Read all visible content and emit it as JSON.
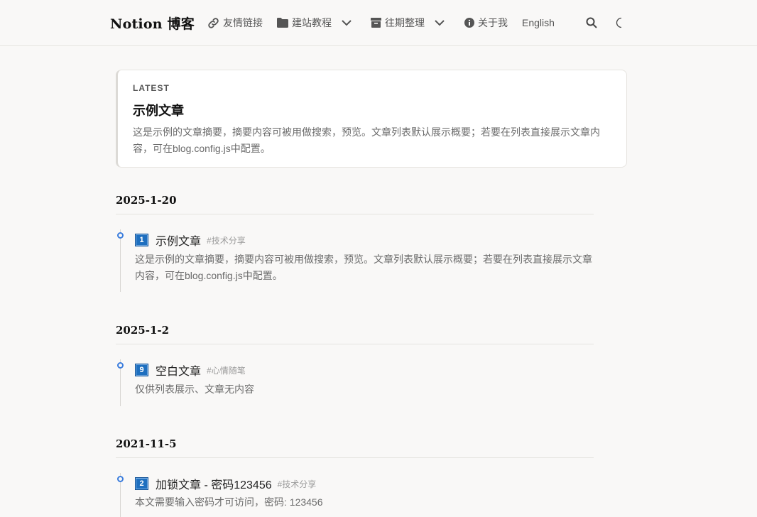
{
  "header": {
    "brand": "Notion 博客",
    "nav": [
      {
        "label": "友情链接",
        "icon": "link-icon"
      },
      {
        "label": "建站教程",
        "icon": "folder-icon",
        "dropdown": true
      },
      {
        "label": "往期整理",
        "icon": "archive-icon",
        "dropdown": true
      },
      {
        "label": "关于我",
        "icon": "info-icon"
      },
      {
        "label": "English"
      }
    ],
    "actions": {
      "search_icon": "search-icon",
      "theme_icon": "moon-icon"
    }
  },
  "latest": {
    "tag": "LATEST",
    "title": "示例文章",
    "summary": "这是示例的文章摘要，摘要内容可被用做搜索，预览。文章列表默认展示概要；若要在列表直接展示文章内容，可在blog.config.js中配置。"
  },
  "groups": [
    {
      "date": "2025-1-20",
      "posts": [
        {
          "num": "1",
          "title": "示例文章",
          "tag": "#技术分享",
          "summary": "这是示例的文章摘要，摘要内容可被用做搜索，预览。文章列表默认展示概要；若要在列表直接展示文章内容，可在blog.config.js中配置。"
        }
      ]
    },
    {
      "date": "2025-1-2",
      "posts": [
        {
          "num": "9",
          "title": "空白文章",
          "tag": "#心情随笔",
          "summary": "仅供列表展示、文章无内容"
        }
      ]
    },
    {
      "date": "2021-11-5",
      "posts": [
        {
          "num": "2",
          "title": "加锁文章 - 密码123456",
          "tag": "#技术分享",
          "summary": "本文需要输入密码才可访问，密码: 123456"
        }
      ]
    }
  ],
  "colors": {
    "accent": "#3b7ddd",
    "badge": "#1e6fbf",
    "background": "#f9f8f7"
  }
}
